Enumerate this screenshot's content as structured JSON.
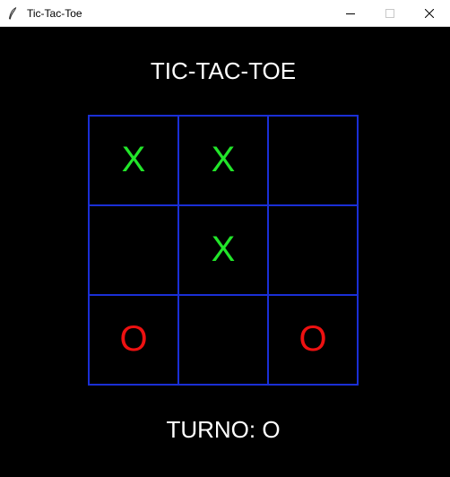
{
  "window": {
    "title": "Tic-Tac-Toe",
    "icon": "feather-icon",
    "controls": [
      "minimize",
      "maximize",
      "close"
    ]
  },
  "game": {
    "title": "TIC-TAC-TOE",
    "turn_text": "TURNO: O",
    "board": [
      [
        "X",
        "X",
        ""
      ],
      [
        "",
        "X",
        ""
      ],
      [
        "O",
        "",
        "O"
      ]
    ]
  },
  "colors": {
    "background": "#000000",
    "grid": "#1a2fd6",
    "X": "#22e52a",
    "O": "#ee1111",
    "text": "#ffffff"
  }
}
